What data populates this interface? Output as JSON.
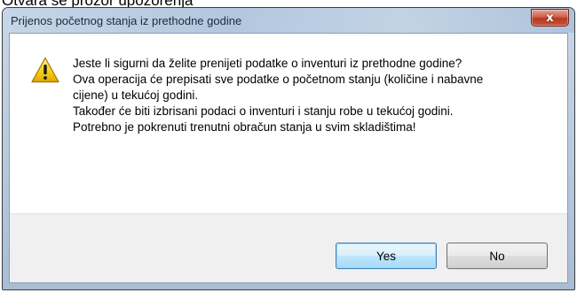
{
  "page": {
    "caption": "Otvara se prozor upozorenja"
  },
  "dialog": {
    "title": "Prijenos početnog stanja iz prethodne godine",
    "close_label": "x",
    "icon": "warning-icon",
    "message": [
      "Jeste li sigurni da želite prenijeti podatke o inventuri iz prethodne godine?",
      "Ova operacija će prepisati sve podatke o početnom stanju (količine i nabavne cijene) u tekućoj godini.",
      "Također će biti izbrisani podaci o inventuri i stanju robe u tekućoj godini. Potrebno je pokrenuti trenutni obračun stanja u svim skladištima!"
    ],
    "buttons": {
      "yes": "Yes",
      "no": "No"
    }
  },
  "colors": {
    "accent": "#3c7fb1",
    "warning": "#f5c400",
    "close": "#c9533a"
  }
}
